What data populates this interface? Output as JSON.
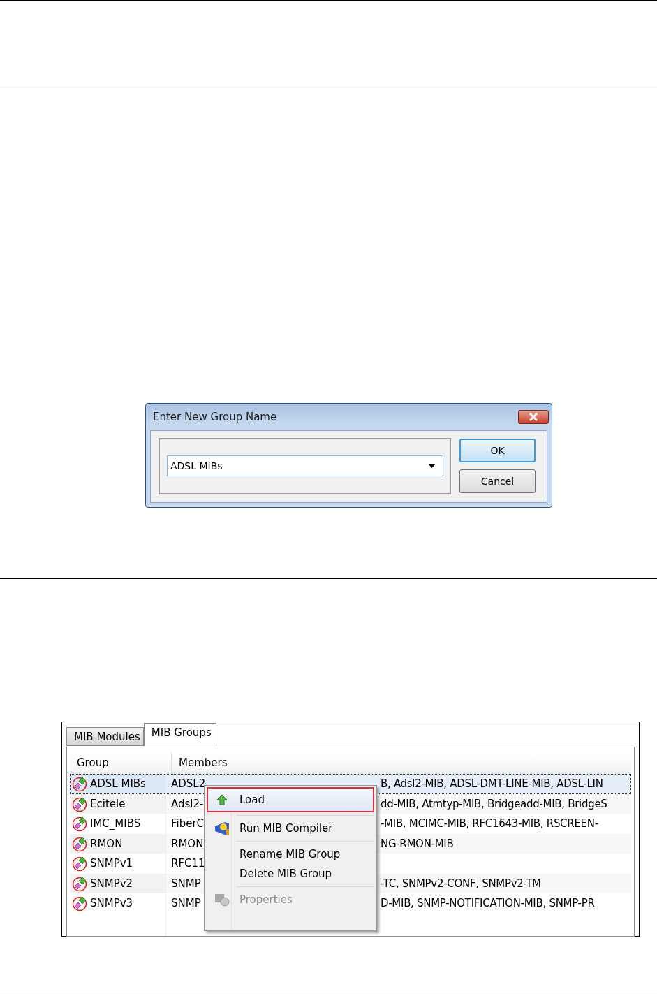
{
  "dialog": {
    "title": "Enter New Group Name",
    "combo_value": "ADSL MIBs",
    "buttons": [
      {
        "label": "OK",
        "default": true
      },
      {
        "label": "Cancel",
        "default": false
      }
    ]
  },
  "panel": {
    "tabs": [
      {
        "label": "MIB Modules",
        "selected": false
      },
      {
        "label": "MIB Groups",
        "selected": true
      }
    ],
    "columns": [
      "Group",
      "Members"
    ],
    "rows": [
      {
        "group": "ADSL MIBs",
        "members_start": "ADSL2",
        "members_end": "B, Adsl2-MIB, ADSL-DMT-LINE-MIB, ADSL-LIN",
        "selected": true
      },
      {
        "group": "Ecitele",
        "members_start": "Adsl2-",
        "members_end": "dd-MIB, Atmtyp-MIB, Bridgeadd-MIB, BridgeS",
        "selected": false
      },
      {
        "group": "IMC_MIBS",
        "members_start": "FiberC",
        "members_end": "-MIB, MCIMC-MIB, RFC1643-MIB, RSCREEN-",
        "selected": false
      },
      {
        "group": "RMON",
        "members_start": "RMON",
        "members_end": "NG-RMON-MIB",
        "selected": false
      },
      {
        "group": "SNMPv1",
        "members_start": "RFC11",
        "members_end": "",
        "selected": false
      },
      {
        "group": "SNMPv2",
        "members_start": "SNMP",
        "members_end": "-TC, SNMPv2-CONF, SNMPv2-TM",
        "selected": false
      },
      {
        "group": "SNMPv3",
        "members_start": "SNMP",
        "members_end": "D-MIB, SNMP-NOTIFICATION-MIB, SNMP-PR",
        "selected": false
      }
    ],
    "context_menu": [
      {
        "kind": "item",
        "label": "Load",
        "highlighted": true,
        "disabled": false
      },
      {
        "kind": "separator"
      },
      {
        "kind": "item",
        "label": "Run MIB Compiler",
        "highlighted": false,
        "disabled": false
      },
      {
        "kind": "separator"
      },
      {
        "kind": "item",
        "label": "Rename MIB Group",
        "highlighted": false,
        "disabled": false
      },
      {
        "kind": "item",
        "label": "Delete MIB Group",
        "highlighted": false,
        "disabled": false
      },
      {
        "kind": "separator"
      },
      {
        "kind": "item",
        "label": "Properties",
        "highlighted": false,
        "disabled": true
      }
    ]
  }
}
